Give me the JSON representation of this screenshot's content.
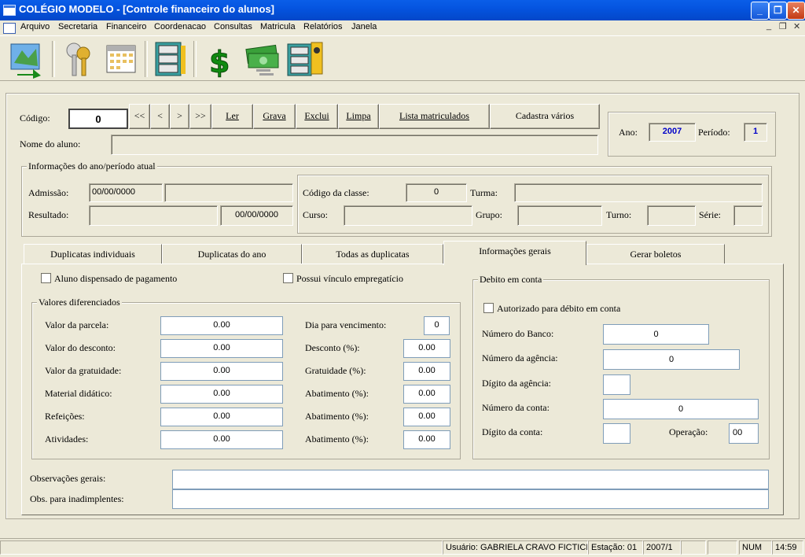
{
  "window": {
    "title": "COLÉGIO MODELO - [Controle financeiro do alunos]"
  },
  "menu": [
    "Arquivo",
    "Secretaria",
    "Financeiro",
    "Coordenacao",
    "Consultas",
    "Matricula",
    "Relatórios",
    "Janela"
  ],
  "toolbar_icons": [
    "map-arrow-icon",
    "keys-icon",
    "calendar-icon",
    "filing-cabinet-icon",
    "dollar-icon",
    "money-icon",
    "file-cabinet-person-icon"
  ],
  "top": {
    "codigo_label": "Código:",
    "codigo_value": "0",
    "nav": [
      "<<",
      "<",
      ">",
      ">>"
    ],
    "buttons": [
      "Ler",
      "Grava",
      "Exclui",
      "Limpa",
      "Lista matriculados",
      "Cadastra vários"
    ],
    "nome_label": "Nome do aluno:",
    "nome_value": "",
    "ano_label": "Ano:",
    "ano_value": "2007",
    "periodo_label": "Período:",
    "periodo_value": "1"
  },
  "info": {
    "title": "Informações do ano/período atual",
    "admissao_label": "Admissão:",
    "admissao_value": "00/00/0000",
    "resultado_label": "Resultado:",
    "resultado_date": "00/00/0000",
    "codigo_classe_label": "Código da classe:",
    "codigo_classe_value": "0",
    "turma_label": "Turma:",
    "curso_label": "Curso:",
    "grupo_label": "Grupo:",
    "turno_label": "Turno:",
    "serie_label": "Série:"
  },
  "tabs": [
    "Duplicatas individuais",
    "Duplicatas do ano",
    "Todas as duplicatas",
    "Informações gerais",
    "Gerar boletos"
  ],
  "general": {
    "dispensado_label": "Aluno dispensado de pagamento",
    "vinculo_label": "Possui vínculo empregatício",
    "valores_title": "Valores diferenciados",
    "left_rows": [
      {
        "label": "Valor da parcela:",
        "value": "0.00"
      },
      {
        "label": "Valor do desconto:",
        "value": "0.00"
      },
      {
        "label": "Valor da gratuidade:",
        "value": "0.00"
      },
      {
        "label": "Material didático:",
        "value": "0.00"
      },
      {
        "label": "Refeições:",
        "value": "0.00"
      },
      {
        "label": "Atividades:",
        "value": "0.00"
      }
    ],
    "right_rows": [
      {
        "label": "Dia para vencimento:",
        "value": "0"
      },
      {
        "label": "Desconto (%):",
        "value": "0.00"
      },
      {
        "label": "Gratuidade (%):",
        "value": "0.00"
      },
      {
        "label": "Abatimento (%):",
        "value": "0.00"
      },
      {
        "label": "Abatimento (%):",
        "value": "0.00"
      },
      {
        "label": "Abatimento (%):",
        "value": "0.00"
      }
    ],
    "debito_title": "Debito em conta",
    "autorizado_label": "Autorizado para débito em conta",
    "numero_banco_label": "Número do Banco:",
    "numero_banco_value": "0",
    "numero_agencia_label": "Número da agência:",
    "numero_agencia_value": "0",
    "digito_agencia_label": "Dígito da agência:",
    "numero_conta_label": "Número da conta:",
    "numero_conta_value": "0",
    "digito_conta_label": "Dígito da conta:",
    "operacao_label": "Operação:",
    "operacao_value": "00",
    "obs_gerais_label": "Observações gerais:",
    "obs_inad_label": "Obs. para inadimplentes:"
  },
  "status": {
    "usuario": "Usuário: GABRIELA CRAVO FICTICIO",
    "estacao": "Estação: 01",
    "periodo": "2007/1",
    "num": "NUM",
    "time": "14:59"
  }
}
